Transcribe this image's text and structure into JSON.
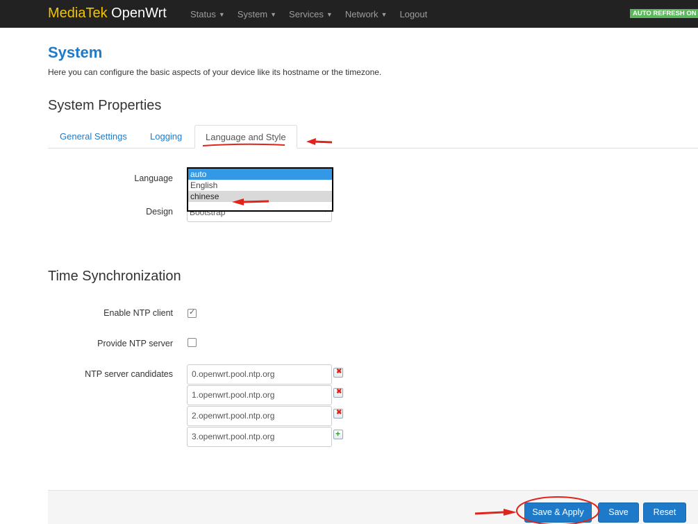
{
  "navbar": {
    "brand_part1": "MediaTek",
    "brand_part2": "OpenWrt",
    "items": [
      {
        "label": "Status",
        "caret": "▼"
      },
      {
        "label": "System",
        "caret": "▼"
      },
      {
        "label": "Services",
        "caret": "▼"
      },
      {
        "label": "Network",
        "caret": "▼"
      },
      {
        "label": "Logout",
        "caret": ""
      }
    ],
    "auto_refresh": "AUTO REFRESH ON"
  },
  "page": {
    "title": "System",
    "description": "Here you can configure the basic aspects of your device like its hostname or the timezone."
  },
  "system_properties": {
    "title": "System Properties",
    "tabs": [
      {
        "label": "General Settings",
        "active": false
      },
      {
        "label": "Logging",
        "active": false
      },
      {
        "label": "Language and Style",
        "active": true
      }
    ],
    "language": {
      "label": "Language",
      "options": [
        "auto",
        "English",
        "chinese"
      ],
      "selected": "auto",
      "highlighted": "chinese"
    },
    "design": {
      "label": "Design",
      "value": "Bootstrap"
    }
  },
  "time_sync": {
    "title": "Time Synchronization",
    "enable_ntp_client": {
      "label": "Enable NTP client",
      "checked": true,
      "tick": "✓"
    },
    "provide_ntp_server": {
      "label": "Provide NTP server",
      "checked": false
    },
    "ntp_candidates_label": "NTP server candidates",
    "ntp_servers": [
      "0.openwrt.pool.ntp.org",
      "1.openwrt.pool.ntp.org",
      "2.openwrt.pool.ntp.org",
      "3.openwrt.pool.ntp.org"
    ],
    "remove_glyph": "✖",
    "add_glyph": "+"
  },
  "actions": {
    "save_apply": "Save & Apply",
    "save": "Save",
    "reset": "Reset"
  },
  "colors": {
    "navbar_bg": "#222222",
    "brand_accent": "#f5c400",
    "link_blue": "#1e7ac9",
    "button_blue": "#1e7ac9",
    "auto_refresh_green": "#5cb85c",
    "annotation_red": "#e0241b"
  }
}
